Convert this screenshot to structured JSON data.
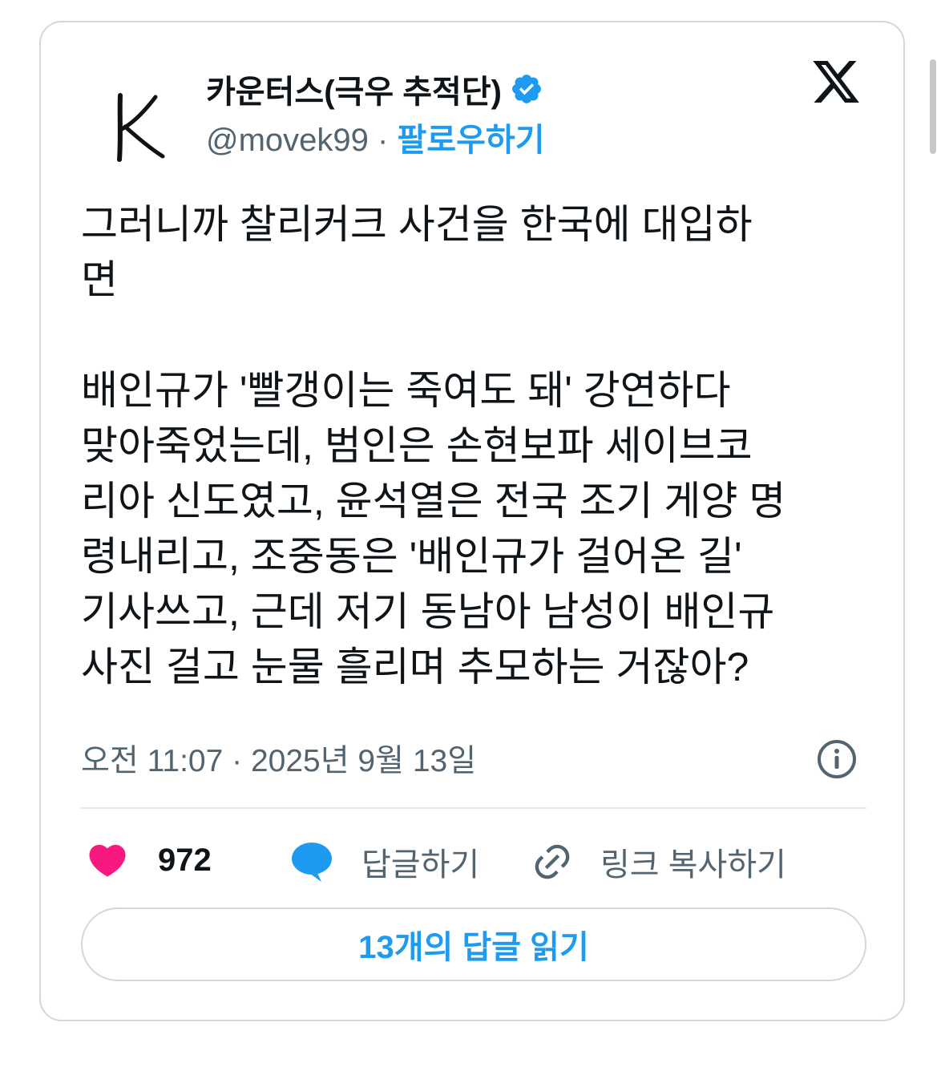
{
  "author": {
    "display_name": "카운터스(극우 추적단)",
    "handle": "@movek99",
    "separator": "·",
    "follow_label": "팔로우하기",
    "avatar_letter": "K",
    "verified": true,
    "verified_icon": "verified-badge-icon"
  },
  "brand": {
    "logo": "x-logo-icon"
  },
  "tweet": {
    "text": "그러니까 찰리커크 사건을 한국에 대입하\n면\n\n배인규가 '빨갱이는 죽여도 돼' 강연하다\n맞아죽었는데, 범인은 손현보파 세이브코\n리아 신도였고, 윤석열은 전국 조기 게양 명\n령내리고, 조중동은 '배인규가 걸어온 길'\n기사쓰고, 근데 저기 동남아 남성이 배인규\n사진 걸고 눈물 흘리며 추모하는 거잖아?",
    "timestamp": "오전 11:07 · 2025년 9월 13일",
    "info_icon": "info-icon"
  },
  "actions": {
    "like_count": "972",
    "reply_label": "답글하기",
    "copy_link_label": "링크 복사하기",
    "read_replies_label": "13개의 답글 읽기"
  },
  "colors": {
    "accent": "#1d9bf0",
    "like": "#f91880",
    "text": "#0f1419",
    "secondary": "#536471",
    "border": "#cfd9de"
  }
}
